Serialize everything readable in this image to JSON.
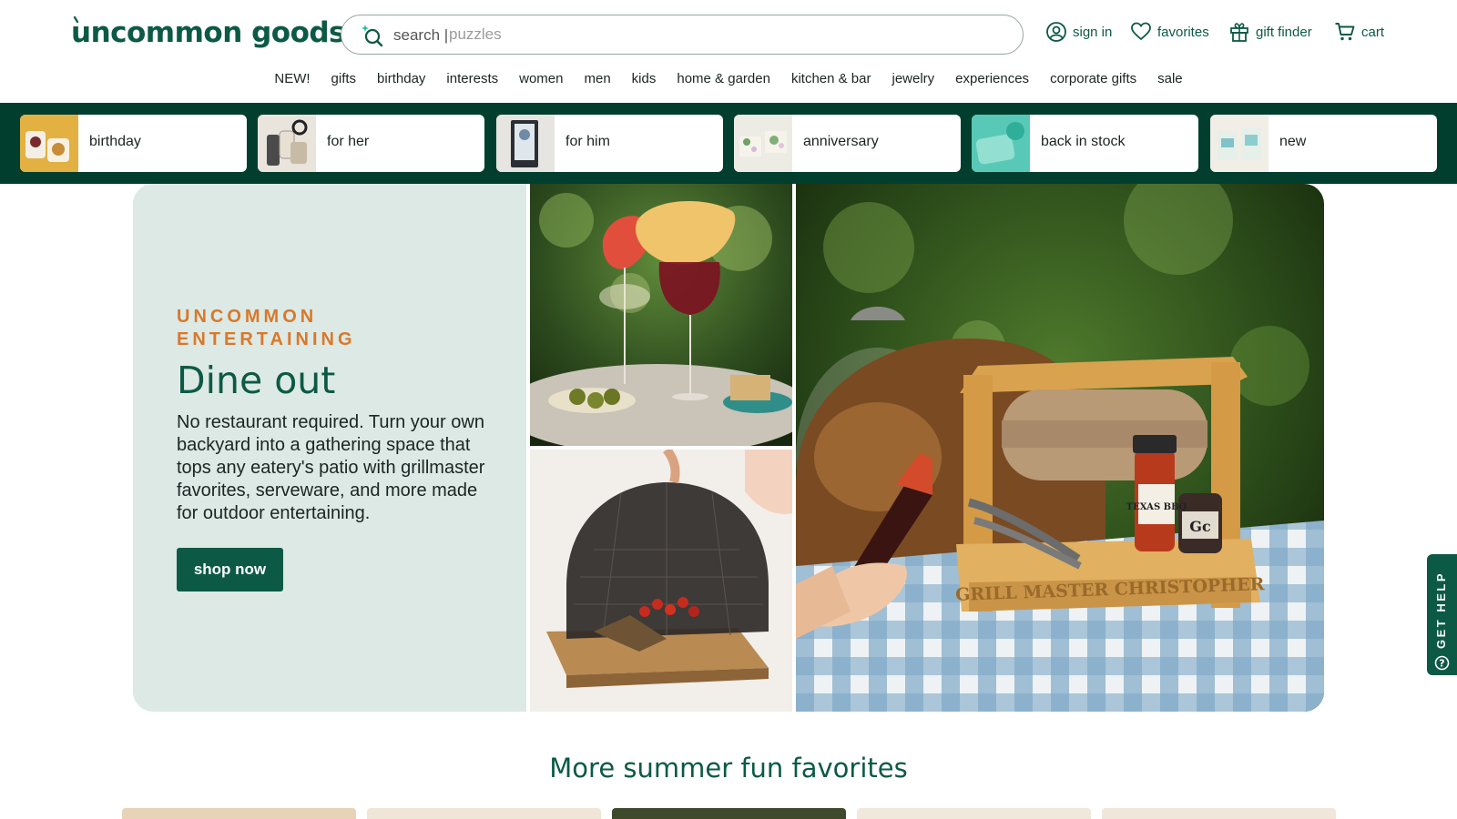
{
  "header": {
    "logo": "uncommon goods",
    "search": {
      "label": "search |",
      "placeholder": "puzzles"
    },
    "utility": [
      {
        "label": "sign in",
        "icon": "user-icon"
      },
      {
        "label": "favorites",
        "icon": "heart-icon"
      },
      {
        "label": "gift finder",
        "icon": "gift-icon"
      },
      {
        "label": "cart",
        "icon": "cart-icon"
      }
    ]
  },
  "nav": {
    "items": [
      "NEW!",
      "gifts",
      "birthday",
      "interests",
      "women",
      "men",
      "kids",
      "home & garden",
      "kitchen & bar",
      "jewelry",
      "experiences",
      "corporate gifts",
      "sale"
    ]
  },
  "occasions": [
    {
      "label": "birthday"
    },
    {
      "label": "for her"
    },
    {
      "label": "for him"
    },
    {
      "label": "anniversary"
    },
    {
      "label": "back in stock"
    },
    {
      "label": "new"
    }
  ],
  "hero": {
    "eyebrow": "UNCOMMON ENTERTAINING",
    "title": "Dine out",
    "copy": "No restaurant required. Turn your own backyard into a gathering space that tops any eatery's patio with grillmaster favorites, serveware, and more made for outdoor entertaining.",
    "cta": "shop now",
    "caddy_engraving": "GRILL MASTER CHRISTOPHER",
    "sauce_label": "TEXAS BBQ",
    "can_label": "Gc"
  },
  "help": {
    "label": "GET HELP"
  },
  "section": {
    "title": "More summer fun favorites"
  },
  "colors": {
    "brand_green": "#0c5a45",
    "strip_green": "#023e2e",
    "accent_orange": "#d9782a",
    "hero_panel": "#dde9e4"
  }
}
